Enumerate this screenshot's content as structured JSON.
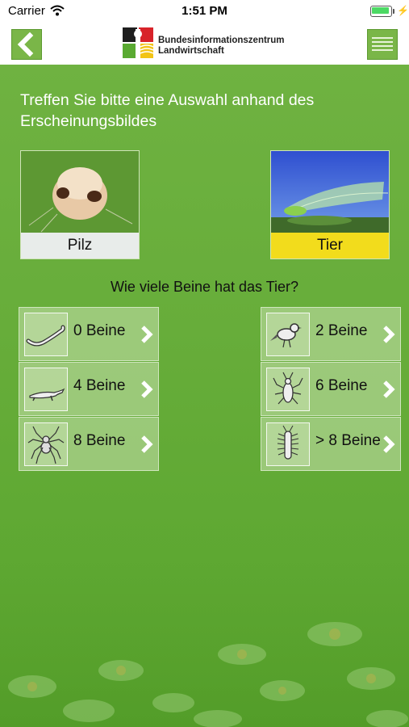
{
  "status_bar": {
    "carrier": "Carrier",
    "time": "1:51 PM",
    "wifi_icon": "wifi-icon",
    "battery_icon": "battery-charging-icon"
  },
  "nav": {
    "back_icon": "chevron-left-icon",
    "menu_icon": "hamburger-menu-icon",
    "logo_line1": "Bundesinformationszentrum",
    "logo_line2": "Landwirtschaft"
  },
  "instruction": "Treffen Sie bitte eine Auswahl anhand des Erscheinungsbildes",
  "choices": [
    {
      "label": "Pilz",
      "selected": false,
      "label_color": "#e8ecea"
    },
    {
      "label": "Tier",
      "selected": true,
      "label_color": "#f2dc1c"
    }
  ],
  "question": "Wie viele Beine hat das Tier?",
  "leg_options": [
    {
      "label": "0 Beine",
      "icon": "worm-icon"
    },
    {
      "label": "2 Beine",
      "icon": "bird-icon"
    },
    {
      "label": "4 Beine",
      "icon": "weasel-icon"
    },
    {
      "label": "6 Beine",
      "icon": "insect-icon"
    },
    {
      "label": "8 Beine",
      "icon": "spider-icon"
    },
    {
      "label": "> 8 Beine",
      "icon": "centipede-icon"
    }
  ],
  "colors": {
    "accent_green": "#7ab648",
    "background_green": "#67ad3a",
    "selected_yellow": "#f2dc1c"
  }
}
